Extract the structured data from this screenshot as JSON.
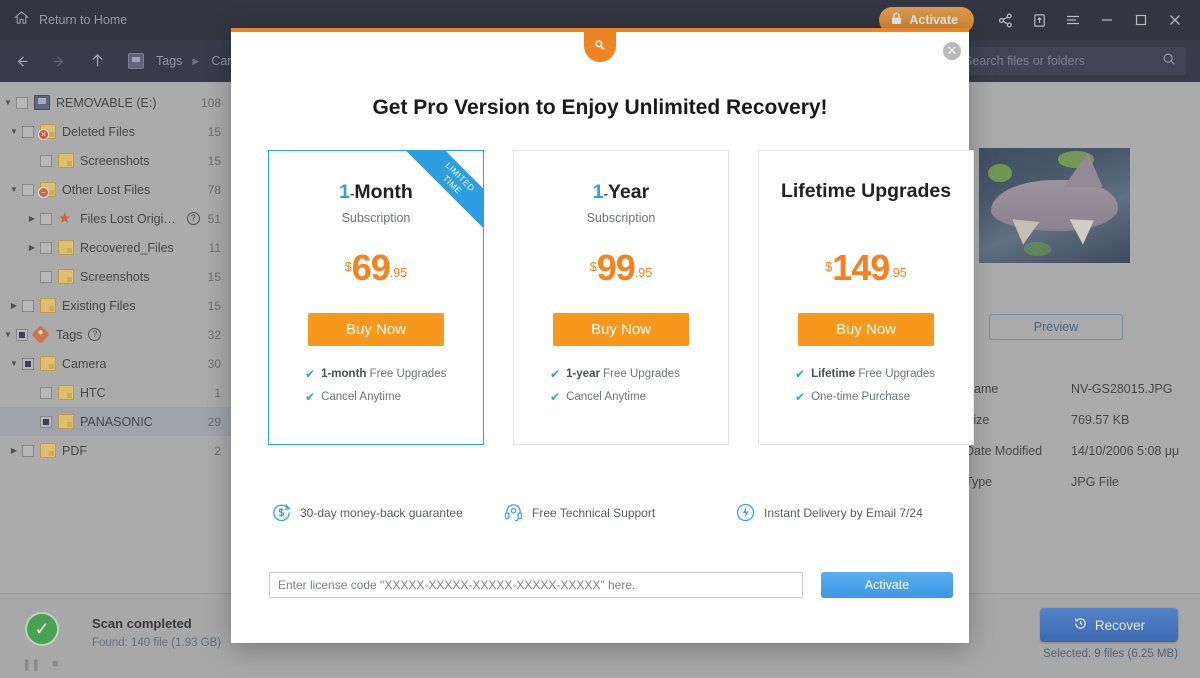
{
  "titlebar": {
    "home_label": "Return to Home",
    "home_icon": "home-icon",
    "activate_label": "Activate",
    "lock_icon": "lock-icon",
    "share_icon": "share-icon",
    "feedback_icon": "upload-box-icon",
    "menu_icon": "hamburger-menu-icon",
    "minimize_icon": "minimize-icon",
    "maximize_icon": "maximize-icon",
    "close_icon": "close-icon"
  },
  "navbar": {
    "back_icon": "arrow-left-icon",
    "forward_icon": "arrow-right-icon",
    "up_icon": "arrow-up-icon",
    "drive_icon": "device-icon",
    "crumb1": "Tags",
    "crumb_sep": "▶",
    "crumb2": "Camera",
    "search_placeholder": "Search files or folders",
    "search_value": "",
    "search_icon": "search-icon"
  },
  "sidebar": {
    "items": [
      {
        "label": "REMOVABLE (E:)",
        "count": "108",
        "indent": 0,
        "twisty": "▼",
        "checked": false,
        "icon": "drive-icon",
        "badge": ""
      },
      {
        "label": "Deleted Files",
        "count": "15",
        "indent": 1,
        "twisty": "▼",
        "checked": false,
        "icon": "folder-icon",
        "badge": "deleted"
      },
      {
        "label": "Screenshots",
        "count": "15",
        "indent": 2,
        "twisty": "",
        "checked": false,
        "icon": "folder-icon",
        "badge": ""
      },
      {
        "label": "Other Lost Files",
        "count": "78",
        "indent": 1,
        "twisty": "▼",
        "checked": false,
        "icon": "folder-icon",
        "badge": "lost"
      },
      {
        "label": "Files Lost Original N...",
        "count": "51",
        "indent": 2,
        "twisty": "▶",
        "checked": false,
        "icon": "star-icon",
        "badge": "",
        "help": "?"
      },
      {
        "label": "Recovered_Files",
        "count": "11",
        "indent": 2,
        "twisty": "▶",
        "checked": false,
        "icon": "folder-icon",
        "badge": ""
      },
      {
        "label": "Screenshots",
        "count": "15",
        "indent": 2,
        "twisty": "",
        "checked": false,
        "icon": "folder-icon",
        "badge": ""
      },
      {
        "label": "Existing Files",
        "count": "15",
        "indent": 1,
        "twisty": "▶",
        "checked": false,
        "icon": "folder-icon",
        "badge": ""
      },
      {
        "label": "Tags",
        "count": "32",
        "indent": 0,
        "twisty": "▼",
        "checked": true,
        "icon": "tag-icon",
        "badge": "",
        "help": "?"
      },
      {
        "label": "Camera",
        "count": "30",
        "indent": 1,
        "twisty": "▼",
        "checked": true,
        "icon": "folder-icon",
        "badge": ""
      },
      {
        "label": "HTC",
        "count": "1",
        "indent": 2,
        "twisty": "",
        "checked": false,
        "icon": "folder-icon",
        "badge": ""
      },
      {
        "label": "PANASONIC",
        "count": "29",
        "indent": 2,
        "twisty": "",
        "checked": true,
        "icon": "folder-icon",
        "badge": "",
        "selected": true
      },
      {
        "label": "PDF",
        "count": "2",
        "indent": 1,
        "twisty": "▶",
        "checked": false,
        "icon": "folder-icon",
        "badge": ""
      }
    ]
  },
  "detail": {
    "preview_label": "Preview",
    "rows": [
      {
        "key": "Name",
        "value": "NV-GS28015.JPG"
      },
      {
        "key": "Size",
        "value": "769.57 KB"
      },
      {
        "key": "Date Modified",
        "value": "14/10/2006 5:08 μμ"
      },
      {
        "key": "Type",
        "value": "JPG File"
      }
    ]
  },
  "status": {
    "check_icon": "check-circle-icon",
    "scan_title": "Scan completed",
    "scan_found": "Found: 140 file (1.93 GB)",
    "pause_icon": "pause-icon",
    "stop_icon": "stop-icon",
    "recover_label": "Recover",
    "recover_icon": "clock-restore-icon",
    "selected_info": "Selected: 9 files (6.25 MB)"
  },
  "modal": {
    "key_icon": "key-icon",
    "close_icon": "close-circle-icon",
    "title": "Get Pro Version to Enjoy Unlimited Recovery!",
    "ribbon_line1": "LIMITED",
    "ribbon_line2": "TIME",
    "cards": [
      {
        "num": "1",
        "dash": "-",
        "unit": "Month",
        "sub": "Subscription",
        "currency": "$",
        "amount": "69",
        "cents": ".95",
        "buy_label": "Buy Now",
        "features": [
          {
            "bold": "1-month",
            "rest": " Free Upgrades"
          },
          {
            "bold": "",
            "rest": "Cancel Anytime"
          }
        ]
      },
      {
        "num": "1",
        "dash": "-",
        "unit": "Year",
        "sub": "Subscription",
        "currency": "$",
        "amount": "99",
        "cents": ".95",
        "buy_label": "Buy Now",
        "features": [
          {
            "bold": "1-year",
            "rest": " Free Upgrades"
          },
          {
            "bold": "",
            "rest": "Cancel Anytime"
          }
        ]
      },
      {
        "num": "",
        "dash": "",
        "unit": "Lifetime Upgrades",
        "sub": "",
        "currency": "$",
        "amount": "149",
        "cents": ".95",
        "buy_label": "Buy Now",
        "features": [
          {
            "bold": "Lifetime",
            "rest": " Free Upgrades"
          },
          {
            "bold": "",
            "rest": "One-time Purchase"
          }
        ]
      }
    ],
    "perks": [
      {
        "icon": "money-back-icon",
        "label": "30-day money-back guarantee"
      },
      {
        "icon": "headset-support-icon",
        "label": "Free Technical Support"
      },
      {
        "icon": "lightning-delivery-icon",
        "label": "Instant Delivery by Email 7/24"
      }
    ],
    "license_placeholder": "Enter license code \"XXXXX-XXXXX-XXXXX-XXXXX-XXXXX\" here.",
    "license_value": "",
    "activate_label": "Activate"
  },
  "colors": {
    "accent_orange": "#f7981d",
    "price_orange": "#f5821f",
    "accent_blue": "#2f9ee0",
    "activate_blue": "#3d97e4",
    "chrome_dark": "#232836"
  }
}
